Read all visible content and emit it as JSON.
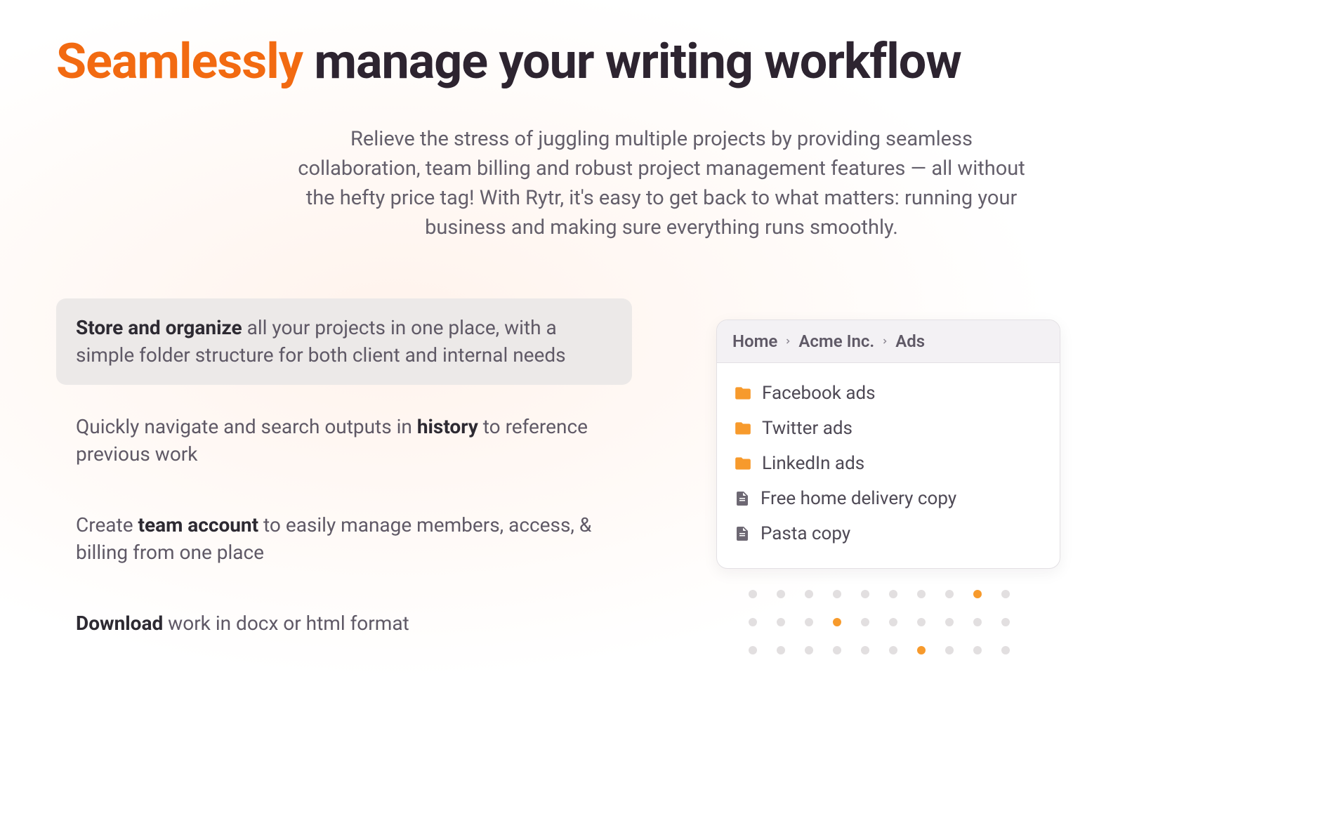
{
  "headline": {
    "accent": "Seamlessly",
    "rest": "manage your writing workflow"
  },
  "subhead": "Relieve the stress of juggling multiple projects by providing seamless collaboration, team billing and robust project management features — all without the hefty price tag! With Rytr, it's easy to get back to what matters: running your business and making sure everything runs smoothly.",
  "features": [
    {
      "bold": "Store and organize",
      "rest": " all your projects in one place, with a simple folder structure for both client and internal needs"
    },
    {
      "pre": "Quickly navigate and search outputs in ",
      "bold": "history",
      "rest": " to reference previous work"
    },
    {
      "pre": "Create ",
      "bold": "team account",
      "rest": " to easily manage members, access, & billing from one place"
    },
    {
      "bold": "Download",
      "rest": " work in docx or html format"
    }
  ],
  "card": {
    "breadcrumbs": [
      "Home",
      "Acme Inc.",
      "Ads"
    ],
    "items": [
      {
        "type": "folder",
        "label": "Facebook ads"
      },
      {
        "type": "folder",
        "label": "Twitter ads"
      },
      {
        "type": "folder",
        "label": "LinkedIn ads"
      },
      {
        "type": "file",
        "label": "Free home delivery copy"
      },
      {
        "type": "file",
        "label": "Pasta copy"
      }
    ]
  },
  "dot_highlights": [
    8,
    13,
    26
  ]
}
